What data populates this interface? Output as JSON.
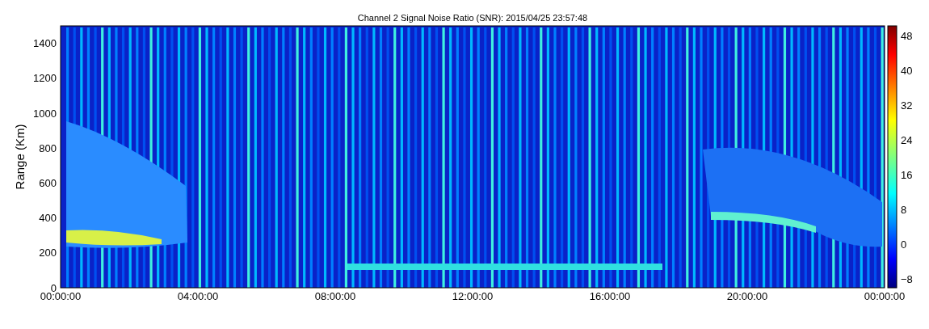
{
  "title": "Channel 2 Signal Noise Ratio (SNR): 2015/04/25 23:57:48",
  "y_axis": {
    "label": "Range (Km)",
    "ticks": [
      "1400",
      "1200",
      "1000",
      "800",
      "600",
      "400",
      "200",
      "0"
    ]
  },
  "x_axis": {
    "ticks": [
      "00:00:00",
      "04:00:00",
      "08:00:00",
      "12:00:00",
      "16:00:00",
      "20:00:00",
      "00:00:00"
    ]
  },
  "colorbar": {
    "ticks": [
      "48",
      "40",
      "32",
      "24",
      "16",
      "8",
      "0",
      "−8"
    ]
  }
}
